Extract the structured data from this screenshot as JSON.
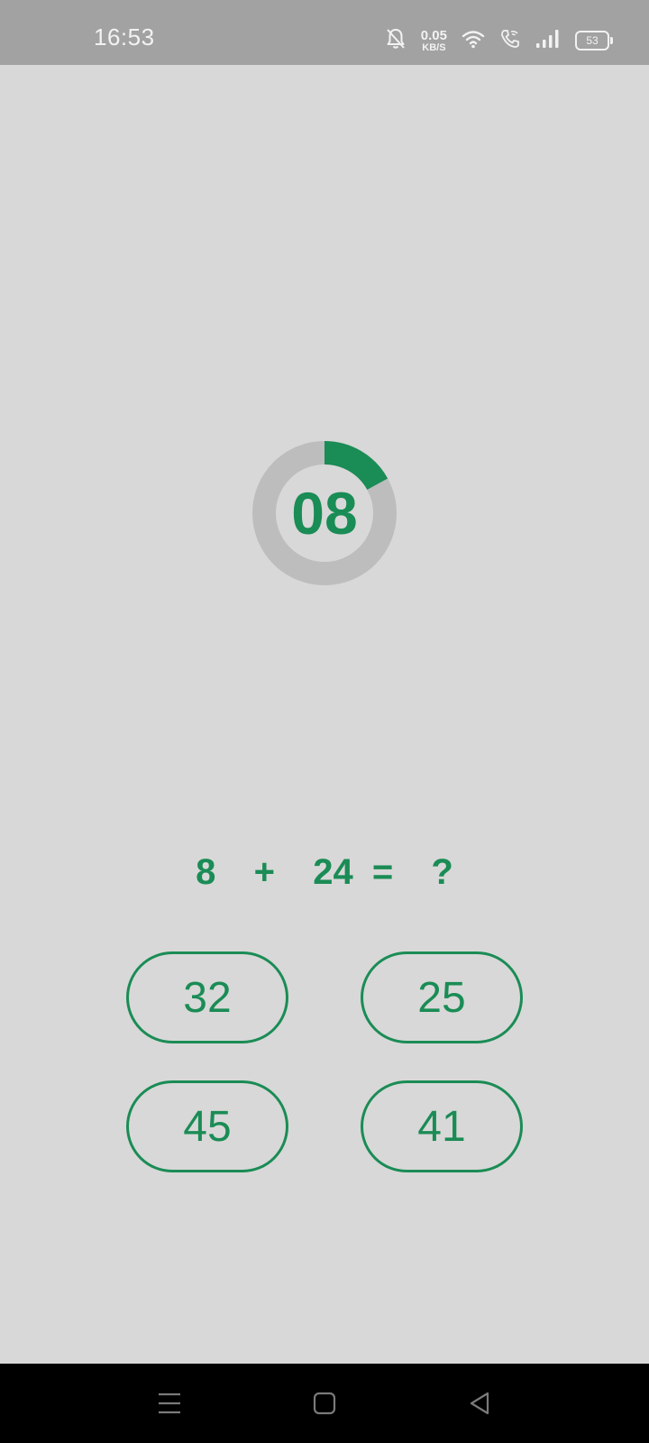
{
  "status_bar": {
    "time": "16:53",
    "net_speed_value": "0.05",
    "net_speed_unit": "KB/S",
    "battery_level": "53",
    "icons": [
      "bell-off-icon",
      "wifi-icon",
      "wifi-call-icon",
      "signal-icon",
      "battery-icon"
    ]
  },
  "timer": {
    "value": "08",
    "progress_fraction": 0.17,
    "colors": {
      "track": "#bdbdbd",
      "fill": "#1a8c55"
    }
  },
  "question": {
    "text": "8  +  24 =  ?"
  },
  "answers": [
    {
      "label": "32"
    },
    {
      "label": "25"
    },
    {
      "label": "45"
    },
    {
      "label": "41"
    }
  ],
  "nav_bar": {
    "icons": [
      "menu-icon",
      "home-icon",
      "back-icon"
    ]
  },
  "colors": {
    "accent": "#1a8c55",
    "background": "#d8d8d8",
    "status_bar": "#a2a2a2"
  }
}
